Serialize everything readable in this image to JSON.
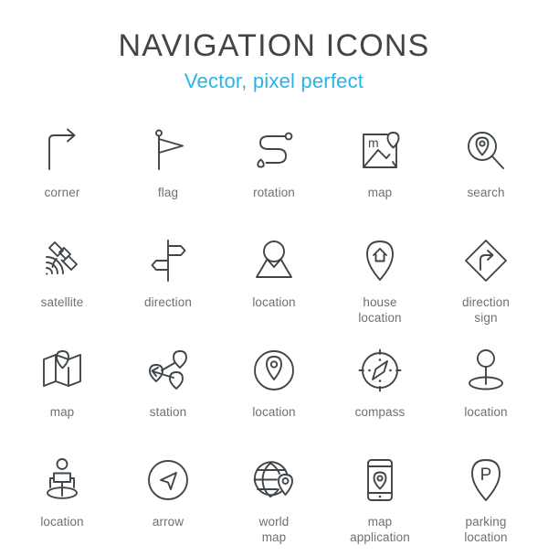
{
  "header": {
    "title": "NAVIGATION ICONS",
    "subtitle": "Vector, pixel perfect",
    "title_color": "#3f4549",
    "subtitle_color": "#29b4e6"
  },
  "palette": {
    "background": "#ffffff",
    "icon_stroke": "#3f4549",
    "label_text": "#6c7175"
  },
  "grid": {
    "columns": 5,
    "rows": 4,
    "total_icons": 20
  },
  "icons": [
    {
      "id": "corner",
      "label": "corner",
      "icon": "corner-arrow-icon"
    },
    {
      "id": "flag",
      "label": "flag",
      "icon": "flag-icon"
    },
    {
      "id": "rotation",
      "label": "rotation",
      "icon": "rotation-route-icon"
    },
    {
      "id": "map-frame",
      "label": "map",
      "icon": "map-image-icon"
    },
    {
      "id": "search",
      "label": "search",
      "icon": "search-pin-icon"
    },
    {
      "id": "satellite",
      "label": "satellite",
      "icon": "satellite-icon"
    },
    {
      "id": "direction",
      "label": "direction",
      "icon": "signpost-icon"
    },
    {
      "id": "location-mountain",
      "label": "location",
      "icon": "location-mountain-icon"
    },
    {
      "id": "house-location",
      "label": "house\nlocation",
      "icon": "house-pin-icon"
    },
    {
      "id": "direction-sign",
      "label": "direction\nsign",
      "icon": "diamond-turn-sign-icon"
    },
    {
      "id": "map-folded",
      "label": "map",
      "icon": "folded-map-pin-icon"
    },
    {
      "id": "station",
      "label": "station",
      "icon": "station-pins-icon"
    },
    {
      "id": "location-circle",
      "label": "location",
      "icon": "pin-in-circle-icon"
    },
    {
      "id": "compass",
      "label": "compass",
      "icon": "compass-icon"
    },
    {
      "id": "location-marker",
      "label": "location",
      "icon": "marker-on-ellipse-icon"
    },
    {
      "id": "location-person",
      "label": "location",
      "icon": "person-on-ellipse-icon"
    },
    {
      "id": "arrow",
      "label": "arrow",
      "icon": "navigation-arrow-circle-icon"
    },
    {
      "id": "world-map",
      "label": "world\nmap",
      "icon": "globe-pin-icon"
    },
    {
      "id": "map-application",
      "label": "map\napplication",
      "icon": "phone-pin-icon"
    },
    {
      "id": "parking-location",
      "label": "parking\nlocation",
      "icon": "parking-pin-icon"
    }
  ],
  "glyph_labels": {
    "map_letter": "m",
    "parking_letter": "P"
  }
}
